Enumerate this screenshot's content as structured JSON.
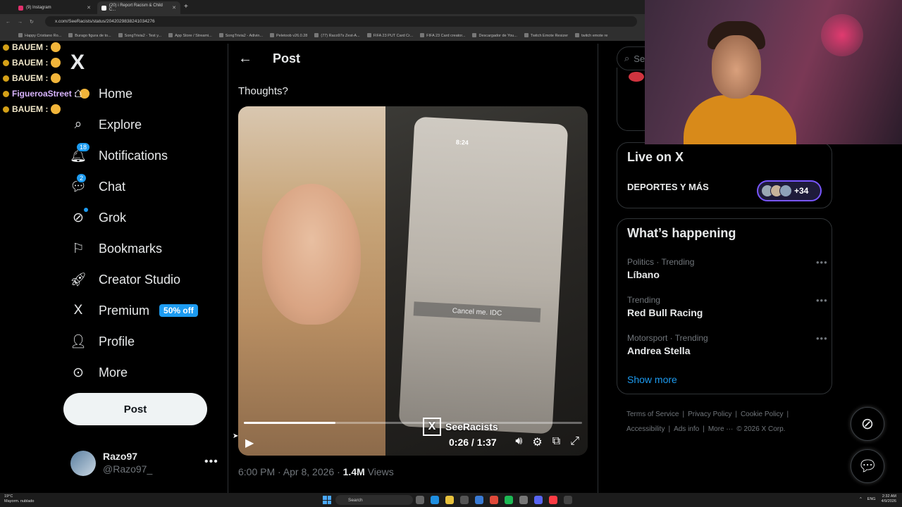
{
  "browser": {
    "tabs": [
      {
        "label": "(9) Instagram"
      },
      {
        "label": "(20) i Report Racism & Child C..."
      }
    ],
    "url": "x.com/SeeRacists/status/2042029838241034276",
    "bookmarks": [
      "Happy Cristiano Ro...",
      "Burago figura de to...",
      "SongTrivia2 - Test y...",
      "App Store / Streami...",
      "SongTrivia2 - Adivin...",
      "Peletoob v26.0.28",
      "(77) Raco97s Zest-A...",
      "FIFA 23 PUT Card Cr...",
      "FIFA 23 Card creator...",
      "Descargador de You...",
      "Twitch Emote Resizer",
      "twitch emote re"
    ]
  },
  "chat": [
    {
      "user": "BAUEM :",
      "color": "#f0e6c8"
    },
    {
      "user": "BAUEM :",
      "color": "#f0e6c8"
    },
    {
      "user": "BAUEM :",
      "color": "#f0e6c8"
    },
    {
      "user": "FigueroaStreet :",
      "color": "#d8b4ff"
    },
    {
      "user": "BAUEM :",
      "color": "#f0e6c8"
    }
  ],
  "nav": {
    "logo": "X",
    "items": [
      {
        "label": "Home",
        "icon": "home-icon"
      },
      {
        "label": "Explore",
        "icon": "search-icon"
      },
      {
        "label": "Notifications",
        "icon": "bell-icon",
        "count": "18"
      },
      {
        "label": "Chat",
        "icon": "chat-icon",
        "count": "2"
      },
      {
        "label": "Grok",
        "icon": "grok-icon"
      },
      {
        "label": "Bookmarks",
        "icon": "bookmark-icon"
      },
      {
        "label": "Creator Studio",
        "icon": "rocket-icon"
      },
      {
        "label": "Premium",
        "icon": "x-icon",
        "badge": "50% off"
      },
      {
        "label": "Profile",
        "icon": "person-icon"
      },
      {
        "label": "More",
        "icon": "more-circle-icon"
      }
    ],
    "post_button": "Post",
    "user": {
      "name": "Razo97",
      "handle": "@Razo97_"
    }
  },
  "post": {
    "header": "Post",
    "text": "Thoughts?",
    "video": {
      "current_time": "0:26",
      "duration": "1:37",
      "time_display": "0:26 / 1:37",
      "progress": 0.27,
      "phone_time": "8:24",
      "caption": "Cancel me. IDC",
      "watermark": "SeeRacists"
    },
    "timestamp": "6:00 PM · Apr 8, 2026 · ",
    "views_count": "1.4M",
    "views_label": " Views"
  },
  "sidebar": {
    "search_placeholder": "Se",
    "live": {
      "title": "Live on X",
      "item": "DEPORTES Y MÁS",
      "extra": "+34"
    },
    "happening": {
      "title": "What’s happening",
      "trends": [
        {
          "category": "Politics · Trending",
          "name": "Líbano"
        },
        {
          "category": "Trending",
          "name": "Red Bull Racing"
        },
        {
          "category": "Motorsport · Trending",
          "name": "Andrea Stella"
        }
      ],
      "show_more": "Show more"
    },
    "footer": [
      "Terms of Service",
      "|",
      "Privacy Policy",
      "|",
      "Cookie Policy",
      "|",
      "Accessibility",
      "|",
      "Ads info",
      "|",
      "More ···",
      "© 2026 X Corp."
    ]
  },
  "taskbar": {
    "weather_temp": "19°C",
    "weather_desc": "Mayorm. nublado",
    "search": "Search",
    "lang": "ENG",
    "time": "2:32 AM",
    "date": "4/9/2026"
  },
  "colors": {
    "accent": "#1d9bf0",
    "background": "#000000",
    "muted": "#71767b"
  }
}
